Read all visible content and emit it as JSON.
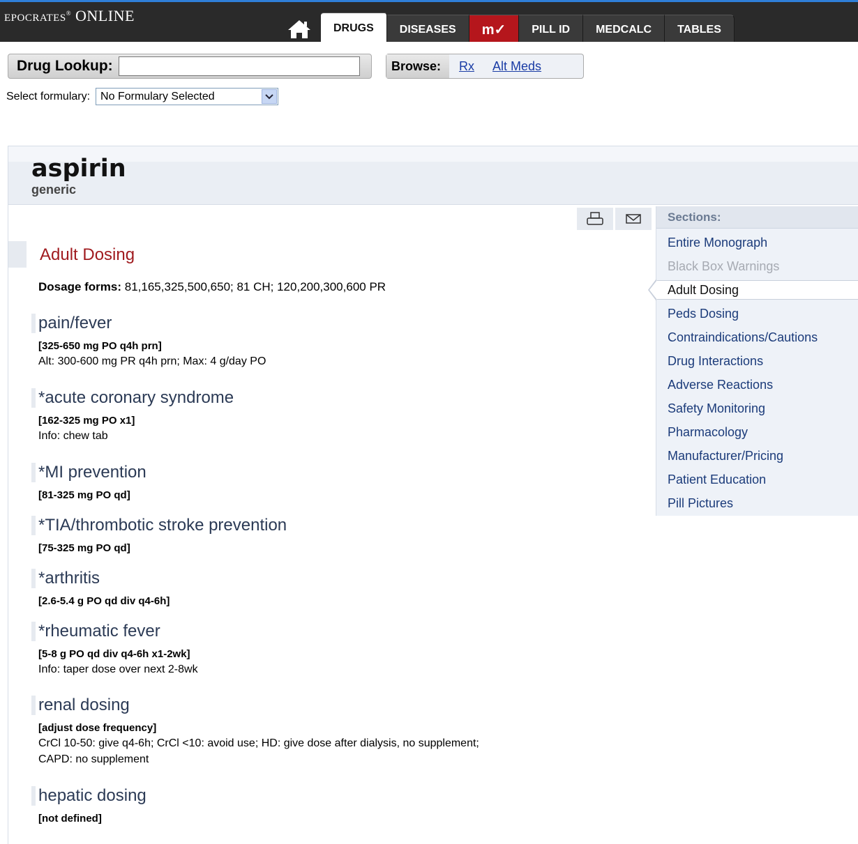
{
  "brand": {
    "logo_text": "EPOCRATES",
    "logo_suffix": "ONLINE",
    "reg": "®"
  },
  "nav": {
    "tabs": [
      {
        "label": "DRUGS"
      },
      {
        "label": "DISEASES"
      },
      {
        "label": "m✓"
      },
      {
        "label": "PILL ID"
      },
      {
        "label": "MEDCALC"
      },
      {
        "label": "TABLES"
      }
    ]
  },
  "lookup": {
    "label": "Drug Lookup:",
    "value": ""
  },
  "browse": {
    "label": "Browse:",
    "links": [
      "Rx",
      "Alt Meds"
    ]
  },
  "formulary": {
    "label": "Select formulary:",
    "selected": "No Formulary Selected"
  },
  "drug": {
    "name": "aspirin",
    "type": "generic"
  },
  "section": {
    "title": "Adult Dosing",
    "dosage_label": "Dosage forms:",
    "dosage_value": "81,165,325,500,650; 81 CH; 120,200,300,600 PR"
  },
  "indications": [
    {
      "title": "pain/fever",
      "dose": "[325-650 mg PO q4h prn]",
      "info": "Alt: 300-600 mg PR q4h prn; Max: 4 g/day PO",
      "info2": ""
    },
    {
      "title": "*acute coronary syndrome",
      "dose": "[162-325 mg PO x1]",
      "info": "Info: chew tab",
      "info2": ""
    },
    {
      "title": "*MI prevention",
      "dose": "[81-325 mg PO qd]",
      "info": "",
      "info2": ""
    },
    {
      "title": "*TIA/thrombotic stroke prevention",
      "dose": "[75-325 mg PO qd]",
      "info": "",
      "info2": ""
    },
    {
      "title": "*arthritis",
      "dose": "[2.6-5.4 g PO qd div q4-6h]",
      "info": "",
      "info2": ""
    },
    {
      "title": "*rheumatic fever",
      "dose": "[5-8 g PO qd div q4-6h x1-2wk]",
      "info": "Info: taper dose over next 2-8wk",
      "info2": ""
    },
    {
      "title": "renal dosing",
      "dose": "[adjust dose frequency]",
      "info": "CrCl 10-50: give q4-6h; CrCl <10: avoid use; HD: give dose after dialysis, no supplement;",
      "info2": "CAPD: no supplement"
    },
    {
      "title": "hepatic dosing",
      "dose": "[not defined]",
      "info": "",
      "info2": ""
    }
  ],
  "sidebar": {
    "heading": "Sections:",
    "items": [
      {
        "label": "Entire Monograph"
      },
      {
        "label": "Black Box Warnings"
      },
      {
        "label": "Adult Dosing"
      },
      {
        "label": "Peds Dosing"
      },
      {
        "label": "Contraindications/Cautions"
      },
      {
        "label": "Drug Interactions"
      },
      {
        "label": "Adverse Reactions"
      },
      {
        "label": "Safety Monitoring"
      },
      {
        "label": "Pharmacology"
      },
      {
        "label": "Manufacturer/Pricing"
      },
      {
        "label": "Patient Education"
      },
      {
        "label": "Pill Pictures"
      }
    ]
  },
  "icons": {
    "home": "home-icon",
    "print": "print-icon",
    "email": "email-icon",
    "dropdown": "chevron-down-icon"
  },
  "colors": {
    "section_title": "#a01b1f",
    "link": "#1a3ca5",
    "mv_tab": "#b5161c",
    "top_accent": "#2f7fd8"
  }
}
